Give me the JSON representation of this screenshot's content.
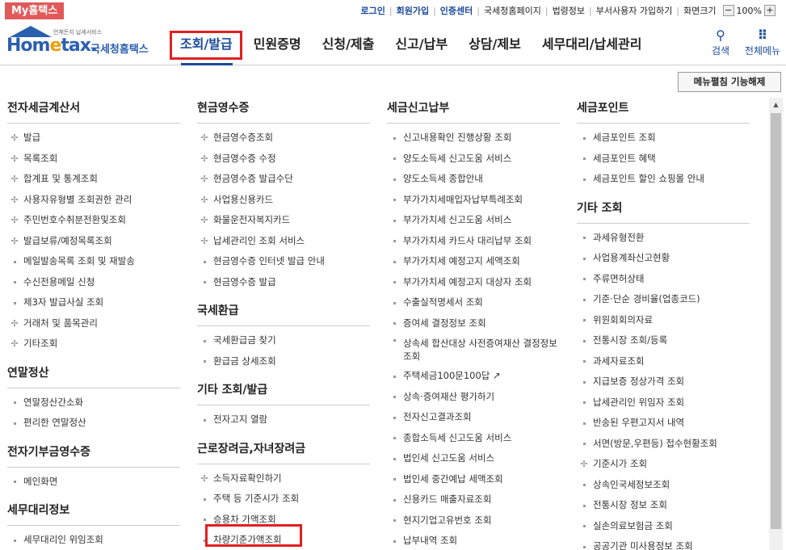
{
  "topbar": {
    "mytax": "My홈택스",
    "links": [
      {
        "label": "로그인",
        "blue": true
      },
      {
        "label": "회원가입",
        "blue": true
      },
      {
        "label": "인증센터",
        "blue": true
      },
      {
        "label": "국세청홈페이지",
        "blue": false
      },
      {
        "label": "법령정보",
        "blue": false
      },
      {
        "label": "부서사용자 가입하기",
        "blue": false
      },
      {
        "label": "화면크기",
        "blue": false
      }
    ],
    "zoom_minus": "−",
    "zoom_value": "100%",
    "zoom_plus": "+"
  },
  "header": {
    "logo_small": "언제든지 납세서비스",
    "logo_word_a": "Hom",
    "logo_word_e": "e",
    "logo_word_b": "tax.",
    "logo_kor": "국세청홈택스",
    "nav": [
      "조회/발급",
      "민원증명",
      "신청/제출",
      "신고/납부",
      "상담/제보",
      "세무대리/납세관리"
    ],
    "search_label": "검색",
    "menu_label": "전체메뉴"
  },
  "unfold_button": "메뉴펼침 기능해제",
  "colors": {
    "brand": "#2b5fb0",
    "accent": "#e02020",
    "mytax": "#e05a5a"
  },
  "columns": [
    {
      "sections": [
        {
          "title": "전자세금계산서",
          "items": [
            {
              "label": "발급",
              "bullet": "plus"
            },
            {
              "label": "목록조회",
              "bullet": "plus"
            },
            {
              "label": "합계표 및 통계조회",
              "bullet": "plus"
            },
            {
              "label": "사용자유형별 조회권한 관리",
              "bullet": "plus"
            },
            {
              "label": "주민번호수취분전환및조회",
              "bullet": "plus"
            },
            {
              "label": "발급보류/예정목록조회",
              "bullet": "plus"
            },
            {
              "label": "메일발송목록 조회 및 재발송",
              "bullet": "sq"
            },
            {
              "label": "수신전용메일 신청",
              "bullet": "sq"
            },
            {
              "label": "제3자 발급사실 조회",
              "bullet": "sq"
            },
            {
              "label": "거래처 및 품목관리",
              "bullet": "plus"
            },
            {
              "label": "기타조회",
              "bullet": "plus"
            }
          ]
        },
        {
          "title": "연말정산",
          "items": [
            {
              "label": "연말정산간소화",
              "bullet": "sq"
            },
            {
              "label": "편리한 연말정산",
              "bullet": "sq"
            }
          ]
        },
        {
          "title": "전자기부금영수증",
          "items": [
            {
              "label": "메인화면",
              "bullet": "sq"
            }
          ]
        },
        {
          "title": "세무대리정보",
          "items": [
            {
              "label": "세무대리인 위임조회",
              "bullet": "sq"
            }
          ]
        }
      ]
    },
    {
      "sections": [
        {
          "title": "현금영수증",
          "items": [
            {
              "label": "현금영수증조회",
              "bullet": "plus"
            },
            {
              "label": "현금영수증 수정",
              "bullet": "plus"
            },
            {
              "label": "현금영수증 발급수단",
              "bullet": "plus"
            },
            {
              "label": "사업용신용카드",
              "bullet": "plus"
            },
            {
              "label": "화물운전자복지카드",
              "bullet": "plus"
            },
            {
              "label": "납세관리인 조회 서비스",
              "bullet": "plus"
            },
            {
              "label": "현금영수증 인터넷 발급 안내",
              "bullet": "sq"
            },
            {
              "label": "현금영수증 발급",
              "bullet": "sq"
            }
          ]
        },
        {
          "title": "국세환급",
          "items": [
            {
              "label": "국세환급금 찾기",
              "bullet": "sq"
            },
            {
              "label": "환급금 상세조회",
              "bullet": "sq"
            }
          ]
        },
        {
          "title": "기타 조회/발급",
          "items": [
            {
              "label": "전자고지 열람",
              "bullet": "sq"
            }
          ]
        },
        {
          "title": "근로장려금,자녀장려금",
          "items": [
            {
              "label": "소득자료확인하기",
              "bullet": "plus"
            },
            {
              "label": "주택 등 기준시가 조회",
              "bullet": "sq"
            },
            {
              "label": "승용차 가액조회",
              "bullet": "sq"
            },
            {
              "label": "차량기준가액조회",
              "bullet": "sq"
            }
          ]
        }
      ]
    },
    {
      "sections": [
        {
          "title": "세금신고납부",
          "items": [
            {
              "label": "신고내용확인 진행상황 조회",
              "bullet": "sq"
            },
            {
              "label": "양도소득세 신고도움 서비스",
              "bullet": "sq"
            },
            {
              "label": "양도소득세 종합안내",
              "bullet": "sq"
            },
            {
              "label": "부가가치세매입자납부특례조회",
              "bullet": "sq"
            },
            {
              "label": "부가가치세 신고도움 서비스",
              "bullet": "sq"
            },
            {
              "label": "부가가치세 카드사 대리납부 조회",
              "bullet": "sq"
            },
            {
              "label": "부가가치세 예정고지 세액조회",
              "bullet": "sq"
            },
            {
              "label": "부가가치세 예정고지 대상자 조회",
              "bullet": "sq"
            },
            {
              "label": "수출실적명세서 조회",
              "bullet": "sq"
            },
            {
              "label": "증여세 결정정보 조회",
              "bullet": "sq"
            },
            {
              "label": "상속세 합산대상 사전증여재산 결정정보 조회",
              "bullet": "sq",
              "two": true
            },
            {
              "label": "주택세금100문100답 ↗",
              "bullet": "sq"
            },
            {
              "label": "상속·증여재산 평가하기",
              "bullet": "sq"
            },
            {
              "label": "전자신고결과조회",
              "bullet": "sq"
            },
            {
              "label": "종합소득세 신고도움 서비스",
              "bullet": "sq"
            },
            {
              "label": "법인세 신고도움 서비스",
              "bullet": "sq"
            },
            {
              "label": "법인세 중간예납 세액조회",
              "bullet": "sq"
            },
            {
              "label": "신용카드 매출자료조회",
              "bullet": "sq"
            },
            {
              "label": "현지기업고유번호 조회",
              "bullet": "sq"
            },
            {
              "label": "납부내역 조회",
              "bullet": "sq"
            }
          ]
        }
      ]
    },
    {
      "sections": [
        {
          "title": "세금포인트",
          "items": [
            {
              "label": "세금포인트 조회",
              "bullet": "sq"
            },
            {
              "label": "세금포인트 혜택",
              "bullet": "sq"
            },
            {
              "label": "세금포인트 할인 쇼핑몰 안내",
              "bullet": "sq"
            }
          ]
        },
        {
          "title": "기타 조회",
          "items": [
            {
              "label": "과세유형전환",
              "bullet": "sq"
            },
            {
              "label": "사업용계좌신고현황",
              "bullet": "sq"
            },
            {
              "label": "주류면허상태",
              "bullet": "sq"
            },
            {
              "label": "기준·단순 경비율(업종코드)",
              "bullet": "sq"
            },
            {
              "label": "위원회회의자료",
              "bullet": "sq"
            },
            {
              "label": "전통시장 조회/등록",
              "bullet": "sq"
            },
            {
              "label": "과세자료조회",
              "bullet": "sq"
            },
            {
              "label": "지급보증 정상가격 조회",
              "bullet": "sq"
            },
            {
              "label": "납세관리인 위임자 조회",
              "bullet": "sq"
            },
            {
              "label": "반송된 우편고지서 내역",
              "bullet": "sq"
            },
            {
              "label": "서면(방문,우편등) 접수현황조회",
              "bullet": "sq"
            },
            {
              "label": "기준시가 조회",
              "bullet": "plus"
            },
            {
              "label": "상속인국세정보조회",
              "bullet": "sq"
            },
            {
              "label": "전통시장 정보 조회",
              "bullet": "sq"
            },
            {
              "label": "실손의료보험금 조회",
              "bullet": "sq"
            },
            {
              "label": "공공기관 미사용정보 조회",
              "bullet": "sq"
            }
          ]
        }
      ]
    }
  ]
}
